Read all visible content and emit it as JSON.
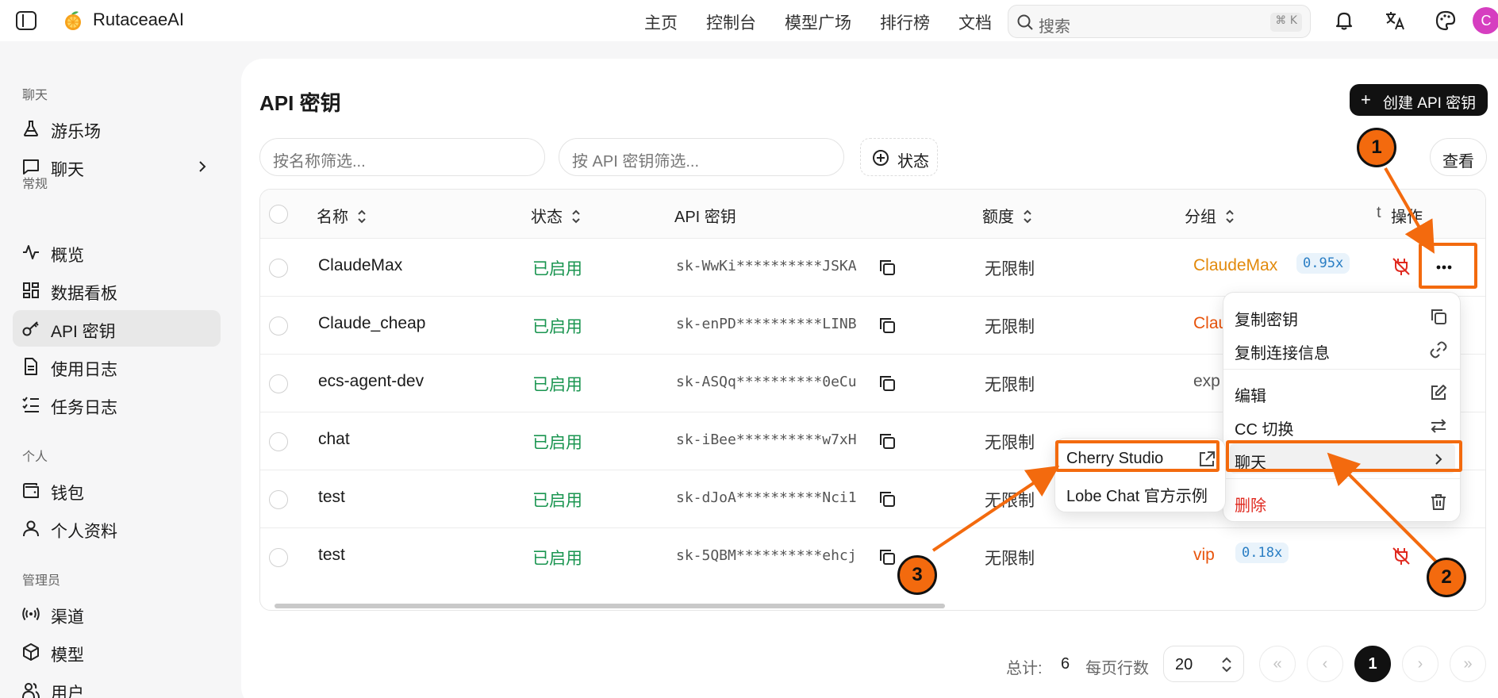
{
  "topbar": {
    "brand": "RutaceaeAI",
    "nav": [
      "主页",
      "控制台",
      "模型广场",
      "排行榜",
      "文档"
    ],
    "search_placeholder": "搜索",
    "search_shortcut": "⌘ K",
    "avatar_initial": "C"
  },
  "sidebar": {
    "sections": {
      "chat": "聊天",
      "general": "常规",
      "personal": "个人",
      "admin": "管理员"
    },
    "items": {
      "playground": "游乐场",
      "chat": "聊天",
      "overview": "概览",
      "dashboard": "数据看板",
      "apikeys": "API 密钥",
      "usage_logs": "使用日志",
      "task_logs": "任务日志",
      "wallet": "钱包",
      "profile": "个人资料",
      "channels": "渠道",
      "models": "模型",
      "users": "用户"
    }
  },
  "page": {
    "title": "API 密钥",
    "create_button": "创建 API 密钥",
    "filter_name_placeholder": "按名称筛选...",
    "filter_key_placeholder": "按 API 密钥筛选...",
    "status_filter": "状态",
    "view_button": "查看"
  },
  "table": {
    "headers": {
      "name": "名称",
      "status": "状态",
      "key": "API 密钥",
      "quota": "额度",
      "group": "分组",
      "actions": "操作",
      "partial": "t"
    },
    "rows": [
      {
        "name": "ClaudeMax",
        "status": "已启用",
        "key": "sk-WwKi**********JSKA",
        "quota": "无限制",
        "group": "ClaudeMax",
        "group_color": "#e28a0c",
        "ratio": "0.95x"
      },
      {
        "name": "Claude_cheap",
        "status": "已启用",
        "key": "sk-enPD**********LINB",
        "quota": "无限制",
        "group": "Clau",
        "group_color": "#e8540c",
        "ratio": ""
      },
      {
        "name": "ecs-agent-dev",
        "status": "已启用",
        "key": "sk-ASQq**********0eCu",
        "quota": "无限制",
        "group": "exp",
        "group_color": "#555555",
        "ratio": ""
      },
      {
        "name": "chat",
        "status": "已启用",
        "key": "sk-iBee**********w7xH",
        "quota": "无限制",
        "group": "",
        "group_color": "#e8540c",
        "ratio": ""
      },
      {
        "name": "test",
        "status": "已启用",
        "key": "sk-dJoA**********Nci1",
        "quota": "无限制",
        "group": "",
        "group_color": "#e8540c",
        "ratio": ""
      },
      {
        "name": "test",
        "status": "已启用",
        "key": "sk-5QBM**********ehcj",
        "quota": "无限制",
        "group": "vip",
        "group_color": "#e8540c",
        "ratio": "0.18x"
      }
    ]
  },
  "pagination": {
    "total_label": "总计:",
    "total": "6",
    "rows_per_page_label": "每页行数",
    "rows_per_page": "20",
    "current_page": "1",
    "first": "«",
    "prev": "‹",
    "next": "›",
    "last": "»"
  },
  "row_menu": {
    "copy_key": "复制密钥",
    "copy_connection": "复制连接信息",
    "edit": "编辑",
    "cc_switch": "CC 切换",
    "chat": "聊天",
    "delete": "删除"
  },
  "chat_submenu": {
    "cherry_studio": "Cherry Studio",
    "lobe_chat": "Lobe Chat 官方示例"
  },
  "annotations": {
    "step1": "1",
    "step2": "2",
    "step3": "3"
  },
  "colors": {
    "accent_annotation": "#f36a0e",
    "status_enabled": "#1a9550",
    "danger": "#e0291f",
    "ratio_text": "#2a7ec4"
  }
}
